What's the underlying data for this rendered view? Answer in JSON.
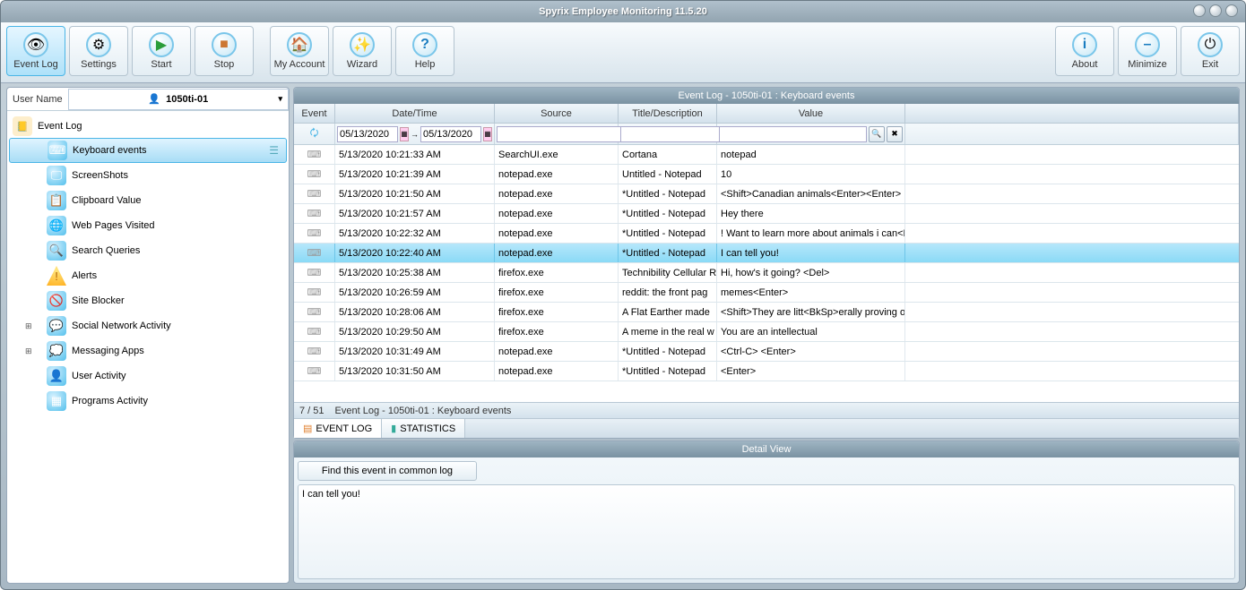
{
  "app_title": "Spyrix Employee Monitoring 11.5.20",
  "toolbar": {
    "event_log": "Event Log",
    "settings": "Settings",
    "start": "Start",
    "stop": "Stop",
    "my_account": "My Account",
    "wizard": "Wizard",
    "help": "Help",
    "about": "About",
    "minimize": "Minimize",
    "exit": "Exit"
  },
  "username_label": "User Name",
  "username_value": "1050ti-01",
  "tree": {
    "root": "Event Log",
    "items": [
      {
        "label": "Keyboard events",
        "glyph": "⌨"
      },
      {
        "label": "ScreenShots",
        "glyph": "🖵"
      },
      {
        "label": "Clipboard Value",
        "glyph": "📋"
      },
      {
        "label": "Web Pages Visited",
        "glyph": "🌐"
      },
      {
        "label": "Search Queries",
        "glyph": "🔍"
      },
      {
        "label": "Alerts",
        "glyph": "!"
      },
      {
        "label": "Site Blocker",
        "glyph": "🚫"
      },
      {
        "label": "Social Network Activity",
        "glyph": "💬",
        "expandable": true
      },
      {
        "label": "Messaging Apps",
        "glyph": "💭",
        "expandable": true
      },
      {
        "label": "User Activity",
        "glyph": "👤"
      },
      {
        "label": "Programs Activity",
        "glyph": "▦"
      }
    ]
  },
  "grid_title": "Event Log - 1050ti-01 : Keyboard events",
  "columns": {
    "event": "Event",
    "datetime": "Date/Time",
    "source": "Source",
    "title": "Title/Description",
    "value": "Value"
  },
  "filter": {
    "date_from": "05/13/2020",
    "date_to": "05/13/2020"
  },
  "rows": [
    {
      "dt": "5/13/2020 10:21:33 AM",
      "src": "SearchUI.exe",
      "title": "Cortana",
      "val": "notepad"
    },
    {
      "dt": "5/13/2020 10:21:39 AM",
      "src": "notepad.exe",
      "title": "Untitled - Notepad",
      "val": "10"
    },
    {
      "dt": "5/13/2020 10:21:50 AM",
      "src": "notepad.exe",
      "title": "*Untitled - Notepad",
      "val": "<Shift>Canadian animals<Enter><Enter>"
    },
    {
      "dt": "5/13/2020 10:21:57 AM",
      "src": "notepad.exe",
      "title": "*Untitled - Notepad",
      "val": "Hey there"
    },
    {
      "dt": "5/13/2020 10:22:32 AM",
      "src": "notepad.exe",
      "title": "*Untitled - Notepad",
      "val": "! Want to learn more about animals i can<Bl"
    },
    {
      "dt": "5/13/2020 10:22:40 AM",
      "src": "notepad.exe",
      "title": "*Untitled - Notepad",
      "val": "I can tell you!",
      "selected": true
    },
    {
      "dt": "5/13/2020 10:25:38 AM",
      "src": "firefox.exe",
      "title": "Technibility Cellular R",
      "val": "Hi, how's it going?   <Del>"
    },
    {
      "dt": "5/13/2020 10:26:59 AM",
      "src": "firefox.exe",
      "title": "reddit: the front pag",
      "val": "memes<Enter>"
    },
    {
      "dt": "5/13/2020 10:28:06 AM",
      "src": "firefox.exe",
      "title": "A Flat Earther made",
      "val": "<Shift>They are litt<BkSp>erally proving o"
    },
    {
      "dt": "5/13/2020 10:29:50 AM",
      "src": "firefox.exe",
      "title": "A meme in the real w",
      "val": "You are an intellectual"
    },
    {
      "dt": "5/13/2020 10:31:49 AM",
      "src": "notepad.exe",
      "title": "*Untitled - Notepad",
      "val": "<Ctrl-C> <Enter>"
    },
    {
      "dt": "5/13/2020 10:31:50 AM",
      "src": "notepad.exe",
      "title": "*Untitled - Notepad",
      "val": "<Enter>"
    }
  ],
  "footer_count": "7 / 51",
  "footer_text": "Event Log - 1050ti-01 : Keyboard events",
  "tabs": {
    "event_log": "EVENT LOG",
    "stats": "STATISTICS"
  },
  "detail_title": "Detail View",
  "find_btn": "Find this event in common log",
  "detail_text": "I can tell you!"
}
